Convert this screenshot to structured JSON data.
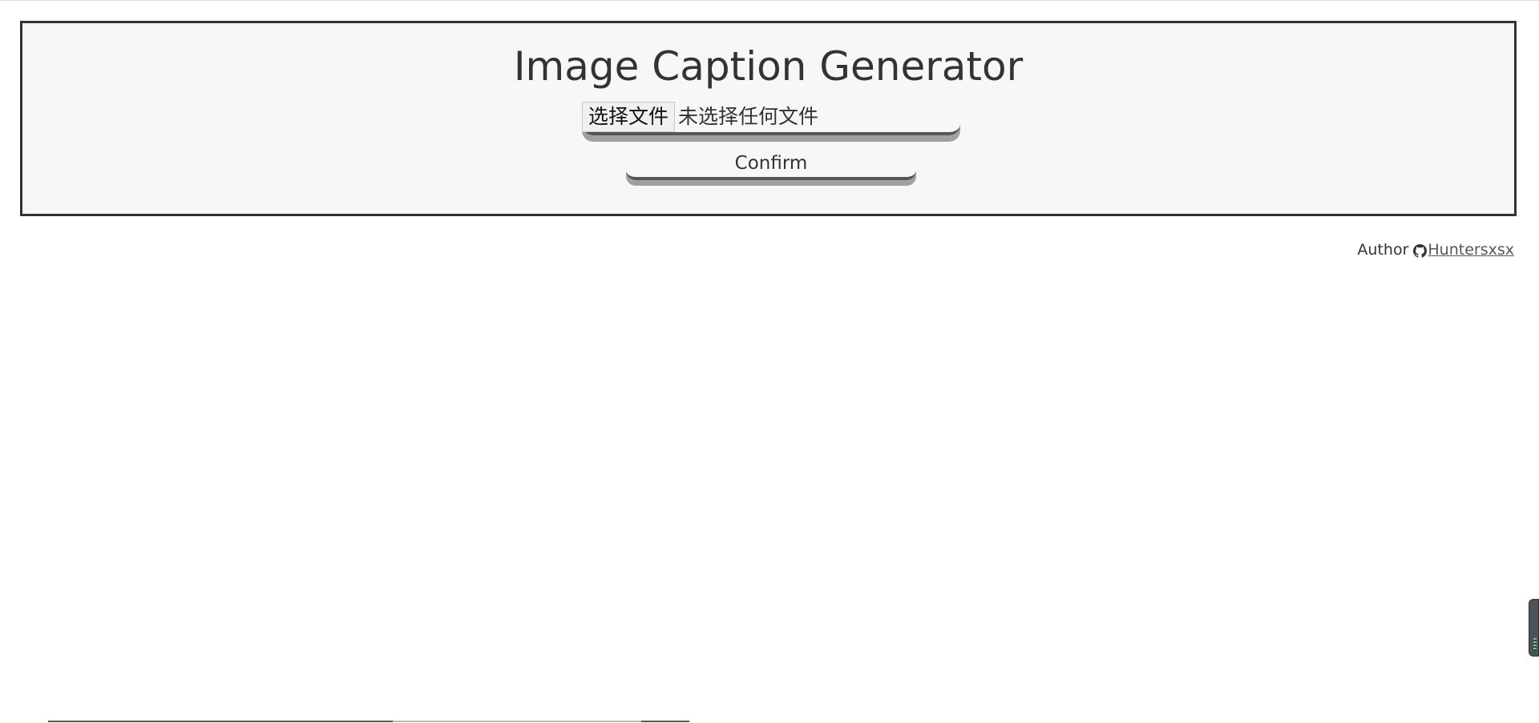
{
  "header": {
    "title": "Image Caption Generator"
  },
  "upload": {
    "choose_file_label": "选择文件",
    "file_status": "未选择任何文件",
    "confirm_label": "Confirm"
  },
  "author": {
    "label": "Author",
    "name": "Huntersxsx",
    "icon": "github-icon"
  },
  "colors": {
    "panel_background": "#f7f7f7",
    "panel_border": "#333333",
    "text": "#333333"
  }
}
